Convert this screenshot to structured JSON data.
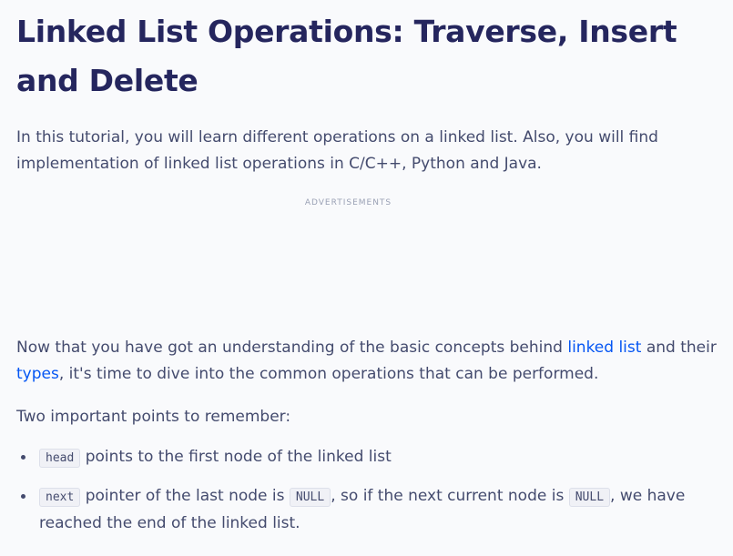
{
  "article": {
    "title": "Linked List Operations: Traverse, Insert and Delete",
    "intro": "In this tutorial, you will learn different operations on a linked list. Also, you will find implementation of linked list operations in C/C++, Python and Java.",
    "ad_label": "ADVERTISEMENTS",
    "p1": {
      "part1": "Now that you have got an understanding of the basic concepts behind ",
      "link1": "linked list",
      "part2": " and their ",
      "link2": "types",
      "part3": ", it's time to dive into the common operations that can be performed."
    },
    "p2": "Two important points to remember:",
    "points": [
      {
        "code1": "head",
        "text1": " points to the first node of the linked list"
      },
      {
        "code1": "next",
        "text1": " pointer of the last node is ",
        "code2": "NULL",
        "text2": ", so if the next current node is ",
        "code3": "NULL",
        "text3": ", we have reached the end of the linked list."
      }
    ]
  },
  "colors": {
    "background": "#f9fafc",
    "heading": "#25265e",
    "body_text": "#444b6e",
    "link": "#0556f3"
  }
}
